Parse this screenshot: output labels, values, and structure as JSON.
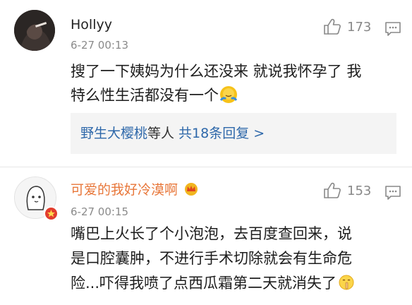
{
  "comments": [
    {
      "username": "Hollyy",
      "date": "6-27 00:13",
      "likes": "173",
      "text_line1": "搜了一下姨妈为什么还没来 就说我怀孕了 我",
      "text_line2": "特么性生活都没有一个",
      "emoji_icon": "shrug-emoji-icon",
      "replies": {
        "names": "野生大樱桃",
        "middle": "等人",
        "total": "共18条回复 >"
      }
    },
    {
      "username": "可爱的我好冷漠啊",
      "username_color": "#e8773a",
      "badge_icon": "crown-badge-icon",
      "date": "6-27 00:15",
      "likes": "153",
      "text_line1": "嘴巴上火长了个小泡泡，去百度查回来，说",
      "text_line2": "是口腔囊肿，不进行手术切除就会有生命危",
      "text_line3": "险...吓得我喷了点西瓜霜第二天就消失了",
      "emoji_icon": "shush-emoji-icon"
    }
  ],
  "colors": {
    "link": "#2e68aa",
    "muted": "#8a8a8a",
    "reply_bg": "#f4f4f4"
  }
}
